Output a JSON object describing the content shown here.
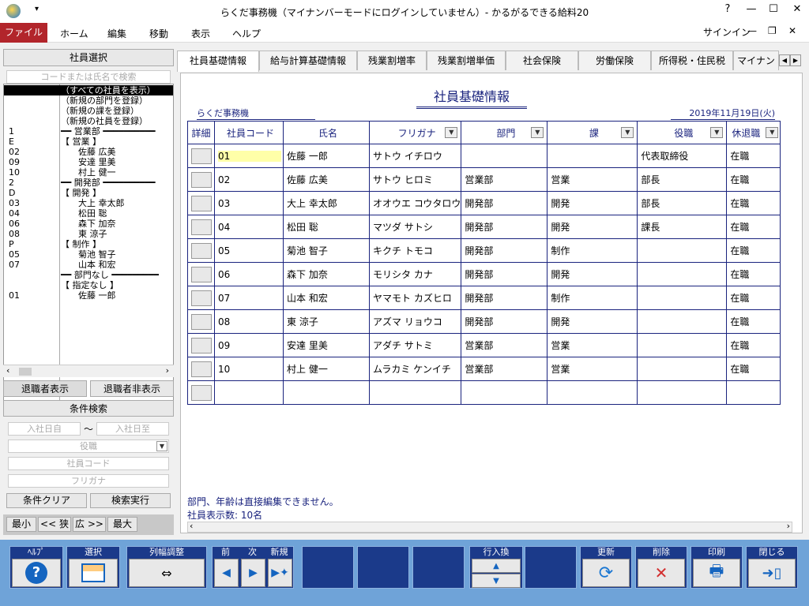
{
  "window": {
    "title": "らくだ事務機（マイナンバーモードにログインしていません）- かるがるできる給料20",
    "help": "?",
    "minimize": "—",
    "maximize": "☐",
    "close": "✕"
  },
  "menu": {
    "file": "ファイル",
    "items": [
      "ホーム",
      "編集",
      "移動",
      "表示",
      "ヘルプ"
    ],
    "signin": "サインイン"
  },
  "left": {
    "title": "社員選択",
    "search_placeholder": "コードまたは氏名で検索",
    "tree": [
      {
        "code": "",
        "name": "（すべての社員を表示）",
        "selected": true
      },
      {
        "code": "",
        "name": "（新規の部門を登録）"
      },
      {
        "code": "",
        "name": "（新規の課を登録）"
      },
      {
        "code": "",
        "name": "（新規の社員を登録）"
      },
      {
        "code": "1",
        "name": "━━ 営業部 ━━━━━━━━━━"
      },
      {
        "code": "E",
        "name": "【 営業 】"
      },
      {
        "code": "02",
        "name": "　　佐藤 広美"
      },
      {
        "code": "09",
        "name": "　　安達 里美"
      },
      {
        "code": "10",
        "name": "　　村上 健一"
      },
      {
        "code": "2",
        "name": "━━ 開発部 ━━━━━━━━━━"
      },
      {
        "code": "D",
        "name": "【 開発 】"
      },
      {
        "code": "03",
        "name": "　　大上 幸太郎"
      },
      {
        "code": "04",
        "name": "　　松田 聡"
      },
      {
        "code": "06",
        "name": "　　森下 加奈"
      },
      {
        "code": "08",
        "name": "　　東 涼子"
      },
      {
        "code": "P",
        "name": "【 制作 】"
      },
      {
        "code": "05",
        "name": "　　菊池 智子"
      },
      {
        "code": "07",
        "name": "　　山本 和宏"
      },
      {
        "code": "",
        "name": "━━ 部門なし ━━━━━━━━━"
      },
      {
        "code": "",
        "name": "【 指定なし 】"
      },
      {
        "code": "01",
        "name": "　　佐藤 一郎"
      }
    ],
    "show_retired": "退職者表示",
    "hide_retired": "退職者非表示",
    "condition_title": "条件検索",
    "join_from": "入社日自",
    "tilde": "〜",
    "join_to": "入社日至",
    "position_ph": "役職",
    "code_ph": "社員コード",
    "furigana_ph": "フリガナ",
    "clear": "条件クリア",
    "search": "検索実行",
    "min": "最小",
    "narrow": "<< 狭",
    "wide": "広 >>",
    "max": "最大"
  },
  "tabs": [
    "社員基礎情報",
    "給与計算基礎情報",
    "残業割増率",
    "残業割増単価",
    "社会保険",
    "労働保険",
    "所得税・住民税",
    "マイナン"
  ],
  "main": {
    "heading": "社員基礎情報",
    "company": "らくだ事務機",
    "date": "2019年11月19日(火)",
    "columns": [
      "詳細",
      "社員コード",
      "氏名",
      "フリガナ",
      "部門",
      "課",
      "役職",
      "休退職"
    ],
    "rows": [
      [
        "01",
        "佐藤 一郎",
        "サトウ イチロウ",
        "",
        "",
        "代表取締役",
        "在職"
      ],
      [
        "02",
        "佐藤 広美",
        "サトウ ヒロミ",
        "営業部",
        "営業",
        "部長",
        "在職"
      ],
      [
        "03",
        "大上 幸太郎",
        "オオウエ コウタロウ",
        "開発部",
        "開発",
        "部長",
        "在職"
      ],
      [
        "04",
        "松田 聡",
        "マツダ サトシ",
        "開発部",
        "開発",
        "課長",
        "在職"
      ],
      [
        "05",
        "菊池 智子",
        "キクチ トモコ",
        "開発部",
        "制作",
        "",
        "在職"
      ],
      [
        "06",
        "森下 加奈",
        "モリシタ カナ",
        "開発部",
        "開発",
        "",
        "在職"
      ],
      [
        "07",
        "山本 和宏",
        "ヤマモト カズヒロ",
        "開発部",
        "制作",
        "",
        "在職"
      ],
      [
        "08",
        "東 涼子",
        "アズマ リョウコ",
        "開発部",
        "開発",
        "",
        "在職"
      ],
      [
        "09",
        "安達 里美",
        "アダチ サトミ",
        "営業部",
        "営業",
        "",
        "在職"
      ],
      [
        "10",
        "村上 健一",
        "ムラカミ ケンイチ",
        "営業部",
        "営業",
        "",
        "在職"
      ],
      [
        "",
        "",
        "",
        "",
        "",
        "",
        ""
      ]
    ],
    "note": "部門、年齢は直接編集できません。",
    "count": "社員表示数: 10名"
  },
  "toolbar": {
    "help": "ﾍﾙﾌﾟ",
    "select": "選択",
    "colwidth": "列幅調整",
    "prev": "前",
    "next": "次",
    "new": "新規",
    "rowswap": "行入換",
    "update": "更新",
    "delete": "削除",
    "print": "印刷",
    "close": "閉じる"
  }
}
